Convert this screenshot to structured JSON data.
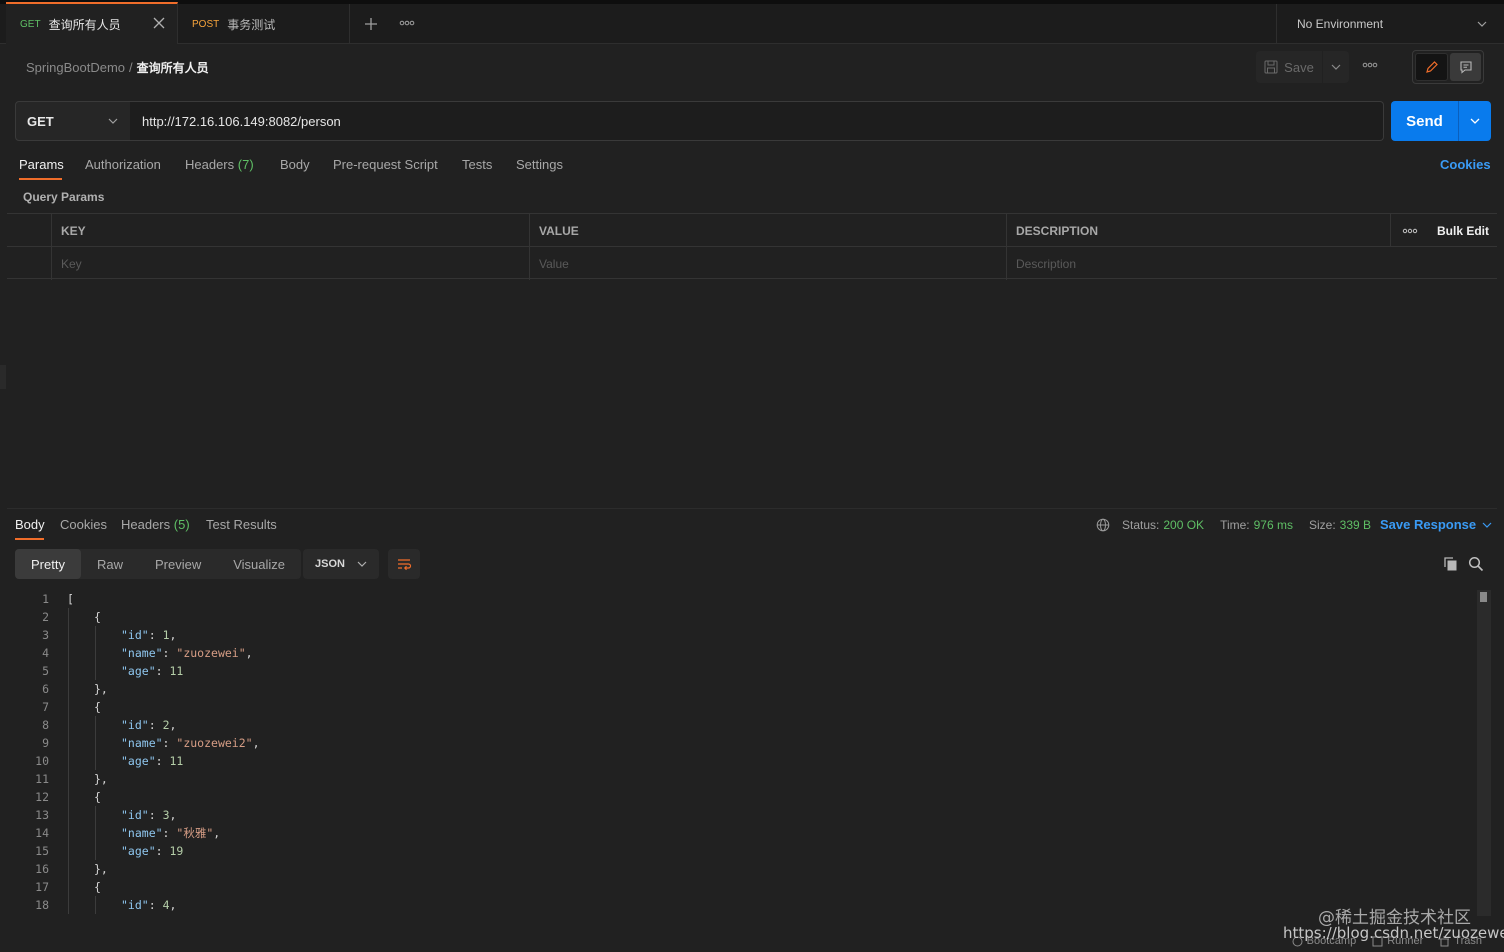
{
  "tabs": [
    {
      "method": "GET",
      "title": "查询所有人员"
    },
    {
      "method": "POST",
      "title": "事务测试"
    }
  ],
  "environment": "No Environment",
  "breadcrumb": {
    "collection": "SpringBootDemo",
    "separator": "/",
    "current": "查询所有人员"
  },
  "header": {
    "save_label": "Save"
  },
  "request": {
    "method": "GET",
    "url": "http://172.16.106.149:8082/person",
    "send_label": "Send"
  },
  "request_tabs": {
    "params": "Params",
    "authorization": "Authorization",
    "headers": "Headers",
    "headers_count": "(7)",
    "body": "Body",
    "pre_request": "Pre-request Script",
    "tests": "Tests",
    "settings": "Settings",
    "cookies": "Cookies"
  },
  "query_params": {
    "label": "Query Params",
    "columns": [
      "KEY",
      "VALUE",
      "DESCRIPTION"
    ],
    "bulk_edit": "Bulk Edit",
    "placeholders": [
      "Key",
      "Value",
      "Description"
    ]
  },
  "response": {
    "tabs": {
      "body": "Body",
      "cookies": "Cookies",
      "headers": "Headers",
      "headers_count": "(5)",
      "tests": "Test Results"
    },
    "status_label": "Status:",
    "status": "200 OK",
    "time_label": "Time:",
    "time": "976 ms",
    "size_label": "Size:",
    "size": "339 B",
    "save_response": "Save Response",
    "views": [
      "Pretty",
      "Raw",
      "Preview",
      "Visualize"
    ],
    "format": "JSON",
    "code_lines": [
      {
        "n": "1",
        "depth": 0,
        "parts": [
          [
            "p",
            "["
          ]
        ]
      },
      {
        "n": "2",
        "depth": 1,
        "parts": [
          [
            "p",
            "{"
          ]
        ]
      },
      {
        "n": "3",
        "depth": 2,
        "parts": [
          [
            "k",
            "\"id\""
          ],
          [
            "p",
            ": "
          ],
          [
            "v",
            "1"
          ],
          [
            "p",
            ","
          ]
        ]
      },
      {
        "n": "4",
        "depth": 2,
        "parts": [
          [
            "k",
            "\"name\""
          ],
          [
            "p",
            ": "
          ],
          [
            "s",
            "\"zuozewei\""
          ],
          [
            "p",
            ","
          ]
        ]
      },
      {
        "n": "5",
        "depth": 2,
        "parts": [
          [
            "k",
            "\"age\""
          ],
          [
            "p",
            ": "
          ],
          [
            "v",
            "11"
          ]
        ]
      },
      {
        "n": "6",
        "depth": 1,
        "parts": [
          [
            "p",
            "},"
          ]
        ]
      },
      {
        "n": "7",
        "depth": 1,
        "parts": [
          [
            "p",
            "{"
          ]
        ]
      },
      {
        "n": "8",
        "depth": 2,
        "parts": [
          [
            "k",
            "\"id\""
          ],
          [
            "p",
            ": "
          ],
          [
            "v",
            "2"
          ],
          [
            "p",
            ","
          ]
        ]
      },
      {
        "n": "9",
        "depth": 2,
        "parts": [
          [
            "k",
            "\"name\""
          ],
          [
            "p",
            ": "
          ],
          [
            "s",
            "\"zuozewei2\""
          ],
          [
            "p",
            ","
          ]
        ]
      },
      {
        "n": "10",
        "depth": 2,
        "parts": [
          [
            "k",
            "\"age\""
          ],
          [
            "p",
            ": "
          ],
          [
            "v",
            "11"
          ]
        ]
      },
      {
        "n": "11",
        "depth": 1,
        "parts": [
          [
            "p",
            "},"
          ]
        ]
      },
      {
        "n": "12",
        "depth": 1,
        "parts": [
          [
            "p",
            "{"
          ]
        ]
      },
      {
        "n": "13",
        "depth": 2,
        "parts": [
          [
            "k",
            "\"id\""
          ],
          [
            "p",
            ": "
          ],
          [
            "v",
            "3"
          ],
          [
            "p",
            ","
          ]
        ]
      },
      {
        "n": "14",
        "depth": 2,
        "parts": [
          [
            "k",
            "\"name\""
          ],
          [
            "p",
            ": "
          ],
          [
            "s",
            "\"秋雅\""
          ],
          [
            "p",
            ","
          ]
        ]
      },
      {
        "n": "15",
        "depth": 2,
        "parts": [
          [
            "k",
            "\"age\""
          ],
          [
            "p",
            ": "
          ],
          [
            "v",
            "19"
          ]
        ]
      },
      {
        "n": "16",
        "depth": 1,
        "parts": [
          [
            "p",
            "},"
          ]
        ]
      },
      {
        "n": "17",
        "depth": 1,
        "parts": [
          [
            "p",
            "{"
          ]
        ]
      },
      {
        "n": "18",
        "depth": 2,
        "parts": [
          [
            "k",
            "\"id\""
          ],
          [
            "p",
            ": "
          ],
          [
            "v",
            "4"
          ],
          [
            "p",
            ","
          ]
        ]
      }
    ]
  },
  "footer": {
    "bootcamp": "Bootcamp",
    "runner": "Runner",
    "trash": "Trash"
  },
  "watermark": {
    "line1": "@稀土掘金技术社区",
    "line2": "https://blog.csdn.net/zuozewei"
  },
  "colors": {
    "accent": "#f06d2a",
    "send": "#097bed",
    "get": "#5fbf65",
    "post": "#f6a33b",
    "link": "#3a9bf5"
  }
}
